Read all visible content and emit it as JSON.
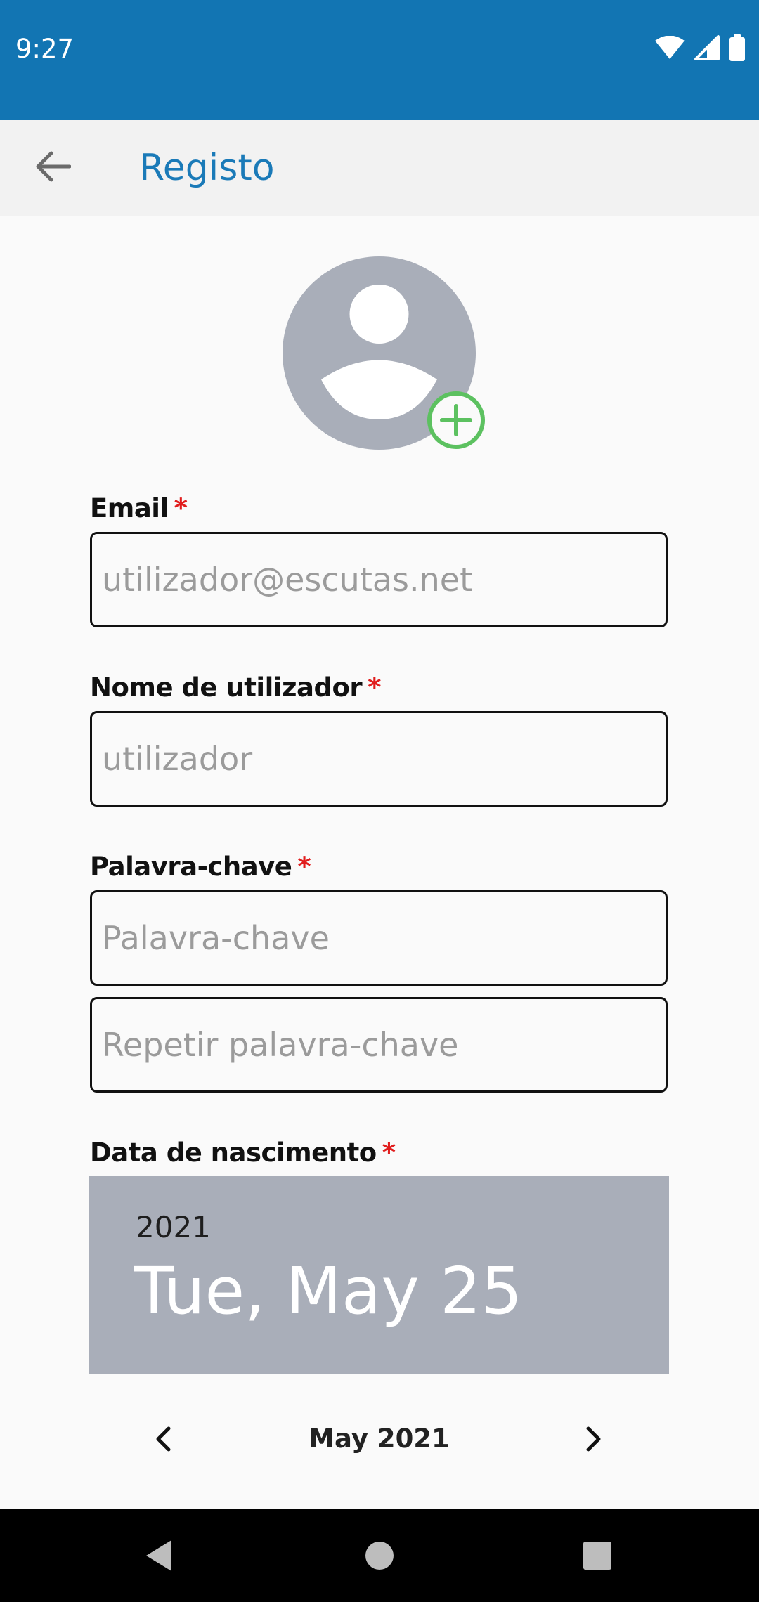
{
  "status_bar": {
    "time": "9:27",
    "icons": [
      "wifi-icon",
      "signal-icon",
      "battery-icon"
    ],
    "background": "#1275b3"
  },
  "app_bar": {
    "title": "Registo",
    "back_icon": "arrow-left-icon",
    "title_color": "#1a7ab8"
  },
  "avatar": {
    "icon": "user-placeholder-icon",
    "add_icon": "add-circle-icon",
    "add_color": "#5cc160"
  },
  "form": {
    "required_marker": "*",
    "email": {
      "label": "Email",
      "placeholder": "utilizador@escutas.net",
      "value": ""
    },
    "username": {
      "label": "Nome de utilizador",
      "placeholder": "utilizador",
      "value": ""
    },
    "password": {
      "label": "Palavra-chave",
      "placeholder": "Palavra-chave",
      "repeat_placeholder": "Repetir palavra-chave",
      "value": "",
      "repeat_value": ""
    },
    "birthdate": {
      "label": "Data de nascimento"
    }
  },
  "date_picker": {
    "year": "2021",
    "selected_date": "Tue, May 25",
    "month_label": "May 2021",
    "prev_icon": "chevron-left-icon",
    "next_icon": "chevron-right-icon",
    "header_color": "#a9aeb9"
  },
  "nav_bar": {
    "back": "nav-back-icon",
    "home": "nav-home-icon",
    "recents": "nav-recents-icon"
  }
}
